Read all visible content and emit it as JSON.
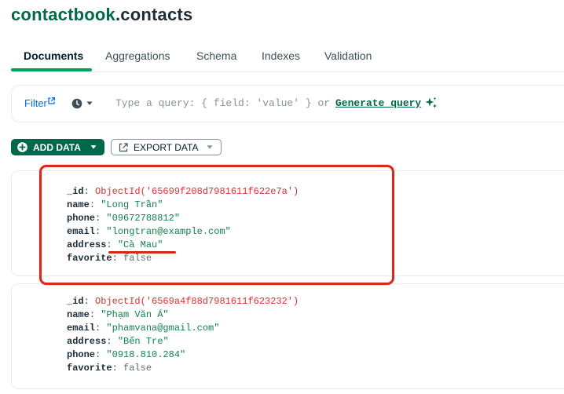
{
  "header": {
    "db": "contactbook",
    "dot_collection": ".contacts"
  },
  "tabs": [
    "Documents",
    "Aggregations",
    "Schema",
    "Indexes",
    "Validation"
  ],
  "filter": {
    "label": "Filter",
    "placeholder": "Type a query: { field: 'value' } or",
    "generate_label": "Generate query"
  },
  "toolbar": {
    "add_label": "ADD DATA",
    "export_label": "EXPORT DATA"
  },
  "documents": [
    {
      "fields": [
        {
          "key": "_id",
          "value": "ObjectId('65699f208d7981611f622e7a')"
        },
        {
          "key": "name",
          "value": "\"Long Trần\""
        },
        {
          "key": "phone",
          "value": "\"09672788812\""
        },
        {
          "key": "email",
          "value": "\"longtran@example.com\""
        },
        {
          "key": "address",
          "value": "\"Cà Mau\""
        },
        {
          "key": "favorite",
          "value": "false"
        }
      ]
    },
    {
      "fields": [
        {
          "key": "_id",
          "value": "ObjectId('6569a4f88d7981611f623232')"
        },
        {
          "key": "name",
          "value": "\"Phạm Văn Á\""
        },
        {
          "key": "email",
          "value": "\"phamvana@gmail.com\""
        },
        {
          "key": "address",
          "value": "\"Bến Tre\""
        },
        {
          "key": "phone",
          "value": "\"0918.810.284\""
        },
        {
          "key": "favorite",
          "value": "false"
        }
      ]
    }
  ],
  "icons": {
    "filter": "external-link-icon",
    "history": "clock-icon",
    "generate": "sparkle-icon",
    "add": "plus-circle-icon",
    "export": "export-icon",
    "dropdown": "caret-down-icon"
  },
  "colors": {
    "brand_green": "#00684a",
    "tab_active_underline": "#00a35c",
    "object_id": "#db3030",
    "string_value": "#12824d",
    "link_blue": "#016bf8",
    "annotation_red": "#d9271a"
  }
}
